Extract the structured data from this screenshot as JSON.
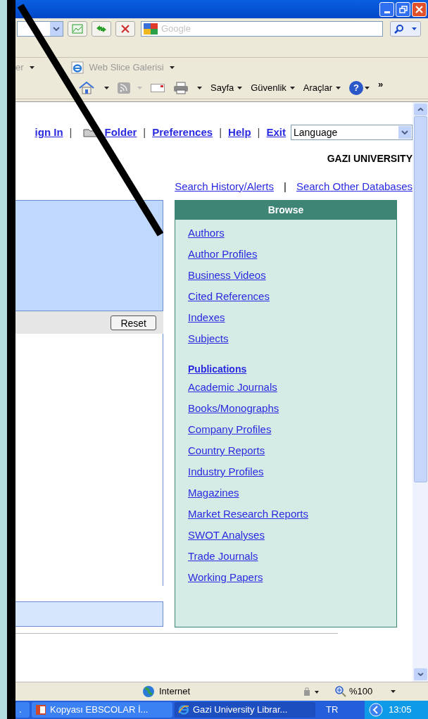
{
  "address_bar": {
    "search_placeholder": "Google"
  },
  "favorites_bar": {
    "items": [
      {
        "label": "er",
        "icon": false
      },
      {
        "label": "Web Slice Galerisi",
        "icon": true
      }
    ]
  },
  "command_bar": {
    "menus": [
      "Sayfa",
      "Güvenlik",
      "Araçlar"
    ],
    "help": "?",
    "overflow": "»"
  },
  "page": {
    "top_links": [
      {
        "label": "ign In",
        "kind": "link"
      },
      {
        "label": "Folder",
        "kind": "folder"
      },
      {
        "label": "Preferences",
        "kind": "link"
      },
      {
        "label": "Help",
        "kind": "link"
      },
      {
        "label": "Exit",
        "kind": "link"
      }
    ],
    "top_link_separators": [
      "|",
      "|",
      "|",
      "|"
    ],
    "links_separator": "|",
    "language_select": {
      "value": "Language"
    },
    "institution": "GAZI UNIVERSITY",
    "links": [
      "Search History/Alerts",
      "Search Other Databases"
    ],
    "reset_button": "Reset",
    "browse": {
      "title": "Browse",
      "items": [
        {
          "label": "Authors",
          "kind": "link"
        },
        {
          "label": "Author Profiles",
          "kind": "link"
        },
        {
          "label": "Business Videos",
          "kind": "link"
        },
        {
          "label": "Cited References",
          "kind": "link"
        },
        {
          "label": "Indexes",
          "kind": "link"
        },
        {
          "label": "Subjects",
          "kind": "link"
        },
        {
          "label": "Publications",
          "kind": "heading"
        },
        {
          "label": "Academic Journals",
          "kind": "link"
        },
        {
          "label": "Books/Monographs",
          "kind": "link"
        },
        {
          "label": "Company Profiles",
          "kind": "link"
        },
        {
          "label": "Country Reports",
          "kind": "link"
        },
        {
          "label": "Industry Profiles",
          "kind": "link"
        },
        {
          "label": "Magazines",
          "kind": "link"
        },
        {
          "label": "Market Research Reports",
          "kind": "link"
        },
        {
          "label": "SWOT Analyses",
          "kind": "link"
        },
        {
          "label": "Trade Journals",
          "kind": "link"
        },
        {
          "label": "Working Papers",
          "kind": "link"
        }
      ]
    }
  },
  "status_bar": {
    "zone": "Internet",
    "zoom": "%100"
  },
  "taskbar": {
    "items": [
      {
        "label": ".",
        "selected": false
      },
      {
        "label": "Kopyası EBSCOLAR İ...",
        "selected": false
      },
      {
        "label": "Gazi University Librar...",
        "selected": true
      }
    ],
    "language": "TR",
    "clock": "13:05"
  }
}
